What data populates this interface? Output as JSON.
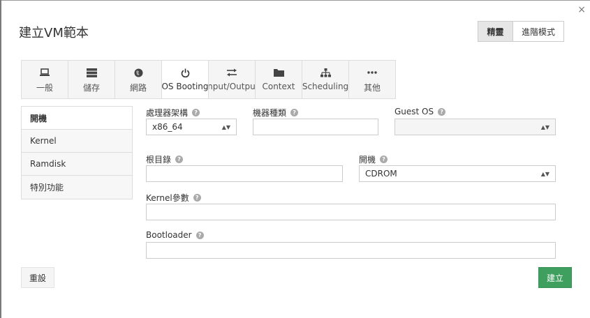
{
  "dialog": {
    "title": "建立VM範本",
    "close_label": "×"
  },
  "mode_toggle": {
    "wizard_label": "精靈",
    "advanced_label": "進階模式",
    "active": "wizard"
  },
  "tabs": [
    {
      "label": "一般",
      "icon": "laptop-icon"
    },
    {
      "label": "儲存",
      "icon": "server-icon"
    },
    {
      "label": "網路",
      "icon": "globe-icon"
    },
    {
      "label": "OS Booting",
      "icon": "power-icon"
    },
    {
      "label": "Input/Output",
      "icon": "exchange-icon"
    },
    {
      "label": "Context",
      "icon": "folder-icon"
    },
    {
      "label": "Scheduling",
      "icon": "sitemap-icon"
    },
    {
      "label": "其他",
      "icon": "ellipsis-icon"
    }
  ],
  "active_tab": "OS Booting",
  "side_menu": [
    {
      "label": "開機"
    },
    {
      "label": "Kernel"
    },
    {
      "label": "Ramdisk"
    },
    {
      "label": "特別功能"
    }
  ],
  "form": {
    "arch": {
      "label": "處理器架構",
      "value": "x86_64"
    },
    "machine": {
      "label": "機器種類",
      "value": ""
    },
    "guest_os": {
      "label": "Guest OS",
      "value": ""
    },
    "root": {
      "label": "根目錄",
      "value": ""
    },
    "boot": {
      "label": "開機",
      "value": "CDROM"
    },
    "kernel_params": {
      "label": "Kernel參數",
      "value": ""
    },
    "bootloader": {
      "label": "Bootloader",
      "value": ""
    }
  },
  "buttons": {
    "reset": "重設",
    "create": "建立"
  },
  "colors": {
    "create_button": "#3e9f5e",
    "help_icon": "#aaaaaa"
  }
}
